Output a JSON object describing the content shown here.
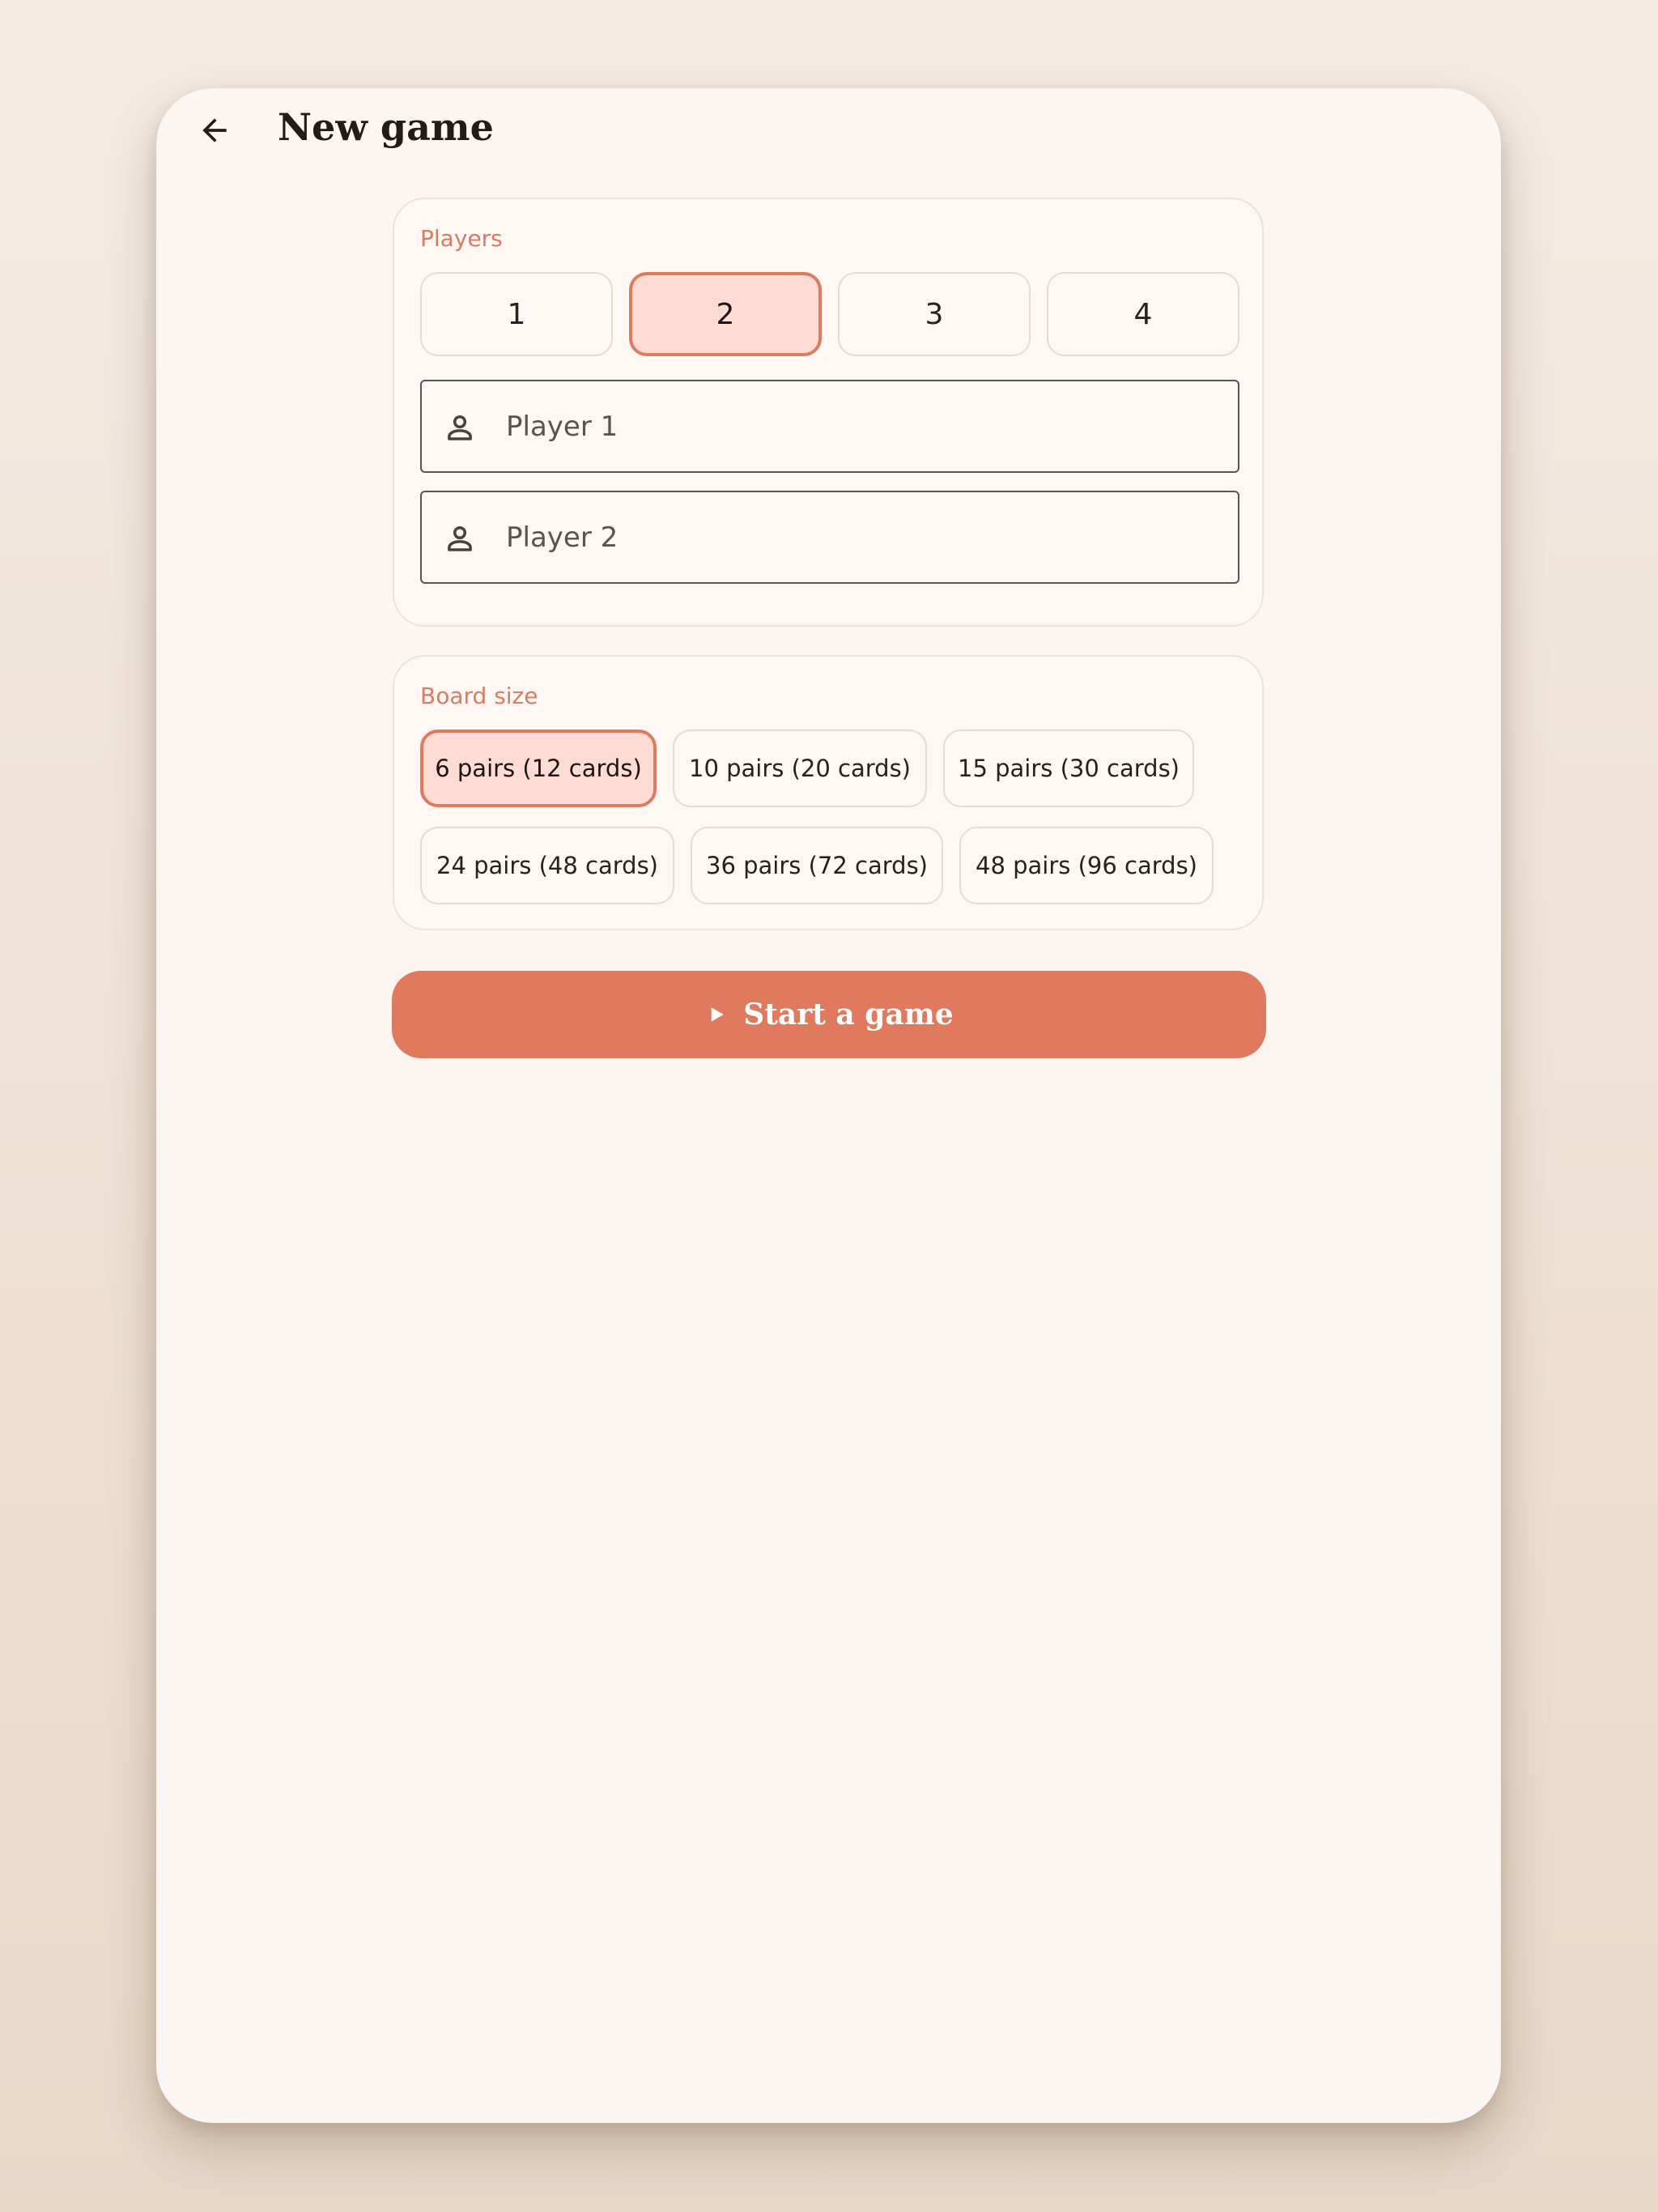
{
  "header": {
    "title": "New game",
    "back_icon": "arrow-left-icon"
  },
  "players": {
    "label": "Players",
    "options": [
      "1",
      "2",
      "3",
      "4"
    ],
    "selected": "2",
    "fields": [
      {
        "placeholder": "Player 1",
        "value": "",
        "icon": "person-icon"
      },
      {
        "placeholder": "Player 2",
        "value": "",
        "icon": "person-icon"
      }
    ]
  },
  "board": {
    "label": "Board size",
    "options": [
      "6 pairs (12 cards)",
      "10 pairs (20 cards)",
      "15 pairs (30 cards)",
      "24 pairs (48 cards)",
      "36 pairs (72 cards)",
      "48 pairs (96 cards)"
    ],
    "selected": "6 pairs (12 cards)"
  },
  "start": {
    "label": "Start a game",
    "icon": "play-icon"
  },
  "colors": {
    "accent": "#e07a5f",
    "selected_fill": "#ffdcd3",
    "label_color": "#d97c60",
    "background": "#fbf6f1"
  }
}
